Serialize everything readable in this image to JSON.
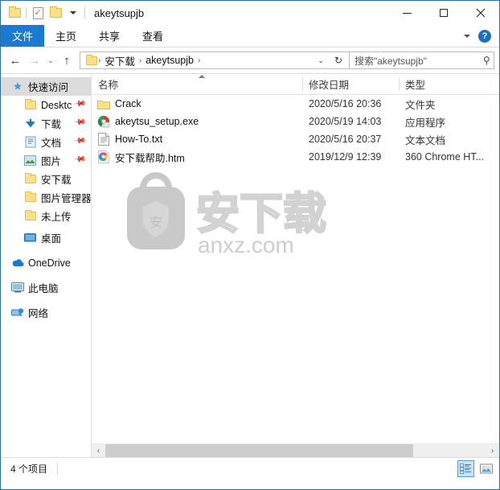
{
  "window": {
    "title": "akeytsupjb",
    "quick_access_toolbar": [
      {
        "name": "folder-properties-icon",
        "label": ""
      },
      {
        "name": "properties-icon",
        "label": ""
      },
      {
        "name": "new-folder-icon",
        "label": ""
      },
      {
        "name": "customize-qat-dropdown",
        "label": ""
      }
    ],
    "controls": {
      "minimize": "—",
      "maximize": "□",
      "close": "✕"
    }
  },
  "ribbon": {
    "tabs": [
      {
        "label": "文件",
        "active": true
      },
      {
        "label": "主页",
        "active": false
      },
      {
        "label": "共享",
        "active": false
      },
      {
        "label": "查看",
        "active": false
      }
    ],
    "collapse_label": "⌄",
    "help_label": "?"
  },
  "navigation": {
    "back": "←",
    "forward": "→",
    "recent": "⌄",
    "up": "↑",
    "breadcrumbs": [
      "安下载",
      "akeytsupjb"
    ],
    "separator": "›",
    "dropdown": "⌄",
    "refresh": "↻"
  },
  "search": {
    "placeholder": "搜索\"akeytsupjb\"",
    "value": "搜索\"akeytsupjb\"",
    "icon": "search-icon"
  },
  "sidebar": {
    "items": [
      {
        "label": "快速访问",
        "icon": "star-pin-icon",
        "level": 1,
        "selected": true,
        "pinned": false
      },
      {
        "label": "Desktc",
        "icon": "folder-icon",
        "level": 2,
        "selected": false,
        "pinned": true
      },
      {
        "label": "下载",
        "icon": "download-icon",
        "level": 2,
        "selected": false,
        "pinned": true
      },
      {
        "label": "文档",
        "icon": "documents-icon",
        "level": 2,
        "selected": false,
        "pinned": true
      },
      {
        "label": "图片",
        "icon": "pictures-icon",
        "level": 2,
        "selected": false,
        "pinned": true
      },
      {
        "label": "安下载",
        "icon": "folder-icon",
        "level": 2,
        "selected": false,
        "pinned": false
      },
      {
        "label": "图片管理器",
        "icon": "folder-icon",
        "level": 2,
        "selected": false,
        "pinned": false
      },
      {
        "label": "未上传",
        "icon": "folder-icon",
        "level": 2,
        "selected": false,
        "pinned": false
      },
      {
        "label": "桌面",
        "icon": "desktop-icon",
        "level": 2,
        "selected": false,
        "pinned": false
      },
      {
        "label": "OneDrive",
        "icon": "onedrive-icon",
        "level": 1,
        "selected": false,
        "pinned": false
      },
      {
        "label": "此电脑",
        "icon": "this-pc-icon",
        "level": 1,
        "selected": false,
        "pinned": false
      },
      {
        "label": "网络",
        "icon": "network-icon",
        "level": 1,
        "selected": false,
        "pinned": false
      }
    ]
  },
  "file_list": {
    "columns": [
      {
        "label": "名称",
        "key": "name"
      },
      {
        "label": "修改日期",
        "key": "date"
      },
      {
        "label": "类型",
        "key": "type"
      }
    ],
    "sort": {
      "column": "名称",
      "direction": "asc"
    },
    "rows": [
      {
        "name": "Crack",
        "date": "2020/5/16 20:36",
        "type": "文件夹",
        "icon": "folder-icon"
      },
      {
        "name": "akeytsu_setup.exe",
        "date": "2020/5/19 14:03",
        "type": "应用程序",
        "icon": "application-icon"
      },
      {
        "name": "How-To.txt",
        "date": "2020/5/16 20:37",
        "type": "文本文档",
        "icon": "text-document-icon"
      },
      {
        "name": "安下载帮助.htm",
        "date": "2019/12/9 12:39",
        "type": "360 Chrome HT...",
        "icon": "chrome-html-icon"
      }
    ]
  },
  "watermark": {
    "badge_char": "安",
    "brand_text": "安下载",
    "domain_text": "anxz.com",
    "color": "#cccccc"
  },
  "scrollbar": {
    "left_arrow": "‹",
    "right_arrow": "›"
  },
  "statusbar": {
    "item_count": "4 个项目",
    "views": [
      {
        "name": "details-view-button",
        "active": true
      },
      {
        "name": "large-icons-view-button",
        "active": false
      }
    ]
  },
  "colors": {
    "accent": "#1a7ad4",
    "folder": "#fbe08a",
    "selection": "#dcdcdc",
    "border": "#2b6f9e"
  }
}
